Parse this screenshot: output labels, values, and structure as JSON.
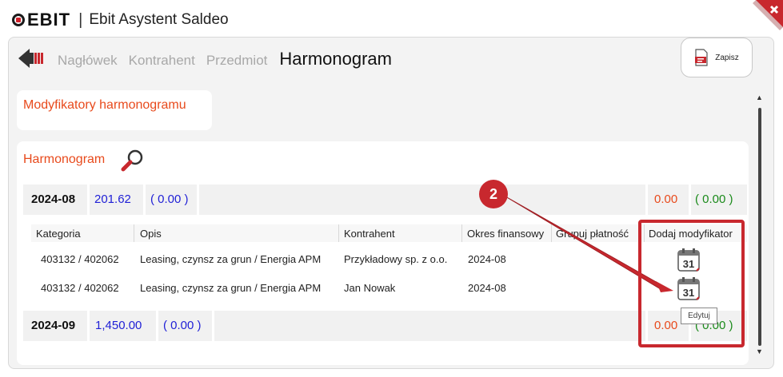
{
  "window": {
    "logo_text": "EBIT",
    "separator": "|",
    "title": "Ebit Asystent Saldeo"
  },
  "nav": {
    "steps": [
      "Nagłówek",
      "Kontrahent",
      "Przedmiot"
    ],
    "active": "Harmonogram"
  },
  "toolbar": {
    "save_label": "Zapisz"
  },
  "sections": {
    "modifiers_title": "Modyfikatory harmonogramu",
    "schedule_title": "Harmonogram"
  },
  "periods": [
    {
      "label": "2024-08",
      "amount": "201.62",
      "sub": "( 0.00 )",
      "right_red": "0.00",
      "right_green": "( 0.00 )"
    },
    {
      "label": "2024-09",
      "amount": "1,450.00",
      "sub": "( 0.00 )",
      "right_red": "0.00",
      "right_green": "( 0.00 )"
    }
  ],
  "table": {
    "columns": [
      "Kategoria",
      "Opis",
      "Kontrahent",
      "Okres finansowy",
      "Grupuj płatność",
      "Dodaj modyfikator"
    ],
    "rows": [
      {
        "kategoria": "403132 / 402062",
        "opis": "Leasing, czynsz za grun / Energia APM",
        "kontrahent": "Przykładowy sp. z o.o.",
        "okres": "2024-08"
      },
      {
        "kategoria": "403132 / 402062",
        "opis": "Leasing, czynsz za grun / Energia APM",
        "kontrahent": "Jan Nowak",
        "okres": "2024-08"
      }
    ],
    "calendar_day": "31"
  },
  "tooltip": "Edytuj",
  "annotation": {
    "badge": "2"
  },
  "colors": {
    "accent_orange": "#e84a1c",
    "amount_blue": "#1f1fd6",
    "green": "#1a8a1a",
    "annotation_red": "#c8282e"
  },
  "icons": [
    "back-arrow-icon",
    "save-pdf-icon",
    "magnifier-icon",
    "calendar-icon",
    "close-icon"
  ]
}
